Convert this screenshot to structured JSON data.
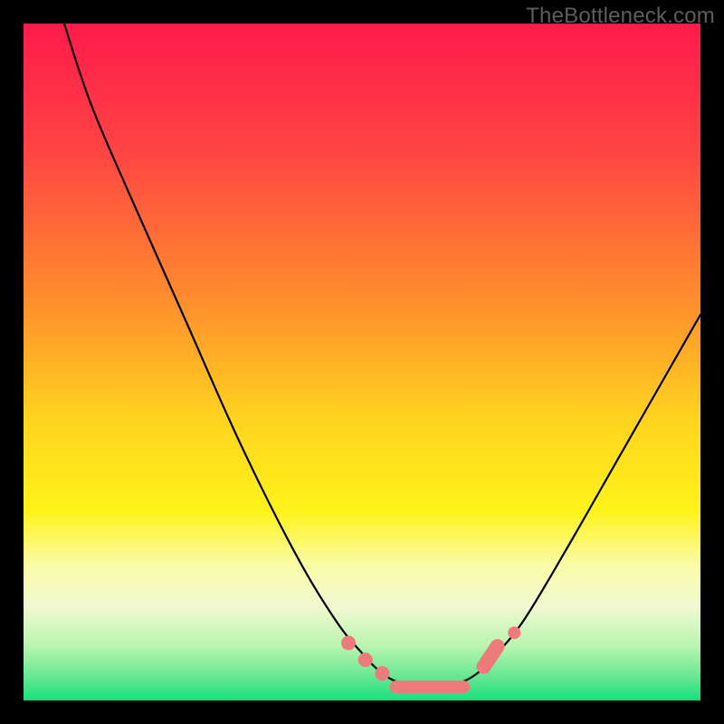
{
  "watermark": "TheBottleneck.com",
  "chart_data": {
    "type": "line",
    "title": "",
    "xlabel": "",
    "ylabel": "",
    "xlim": [
      0,
      100
    ],
    "ylim": [
      0,
      100
    ],
    "gradient_stops": [
      {
        "offset": 0,
        "color": "#ff1a4b"
      },
      {
        "offset": 18,
        "color": "#ff4244"
      },
      {
        "offset": 40,
        "color": "#ff8a2e"
      },
      {
        "offset": 58,
        "color": "#ffd21f"
      },
      {
        "offset": 72,
        "color": "#fff31a"
      },
      {
        "offset": 80,
        "color": "#fafca8"
      },
      {
        "offset": 86,
        "color": "#f2f9d0"
      },
      {
        "offset": 92,
        "color": "#b8f5b0"
      },
      {
        "offset": 97,
        "color": "#5ce690"
      },
      {
        "offset": 100,
        "color": "#18df7f"
      }
    ],
    "series": [
      {
        "name": "bottleneck-curve",
        "points": [
          {
            "x": 6,
            "y": 100
          },
          {
            "x": 10,
            "y": 88
          },
          {
            "x": 16,
            "y": 74
          },
          {
            "x": 24,
            "y": 56
          },
          {
            "x": 32,
            "y": 38
          },
          {
            "x": 40,
            "y": 22
          },
          {
            "x": 46,
            "y": 12
          },
          {
            "x": 50,
            "y": 7
          },
          {
            "x": 53,
            "y": 4
          },
          {
            "x": 56,
            "y": 2.5
          },
          {
            "x": 60,
            "y": 2
          },
          {
            "x": 64,
            "y": 2.5
          },
          {
            "x": 67,
            "y": 4
          },
          {
            "x": 70,
            "y": 7
          },
          {
            "x": 74,
            "y": 12
          },
          {
            "x": 80,
            "y": 22
          },
          {
            "x": 88,
            "y": 36
          },
          {
            "x": 96,
            "y": 50
          },
          {
            "x": 100,
            "y": 57
          }
        ]
      }
    ],
    "markers": {
      "left_cluster": [
        {
          "x": 48,
          "y": 8.5
        },
        {
          "x": 50.5,
          "y": 6
        },
        {
          "x": 53,
          "y": 4
        }
      ],
      "flat_segment": {
        "x0": 55,
        "x1": 65,
        "y": 2
      },
      "right_cluster": {
        "x0": 68,
        "x1": 70,
        "y0": 5,
        "y1": 8
      },
      "right_dot": {
        "x": 72.5,
        "y": 10
      }
    }
  }
}
